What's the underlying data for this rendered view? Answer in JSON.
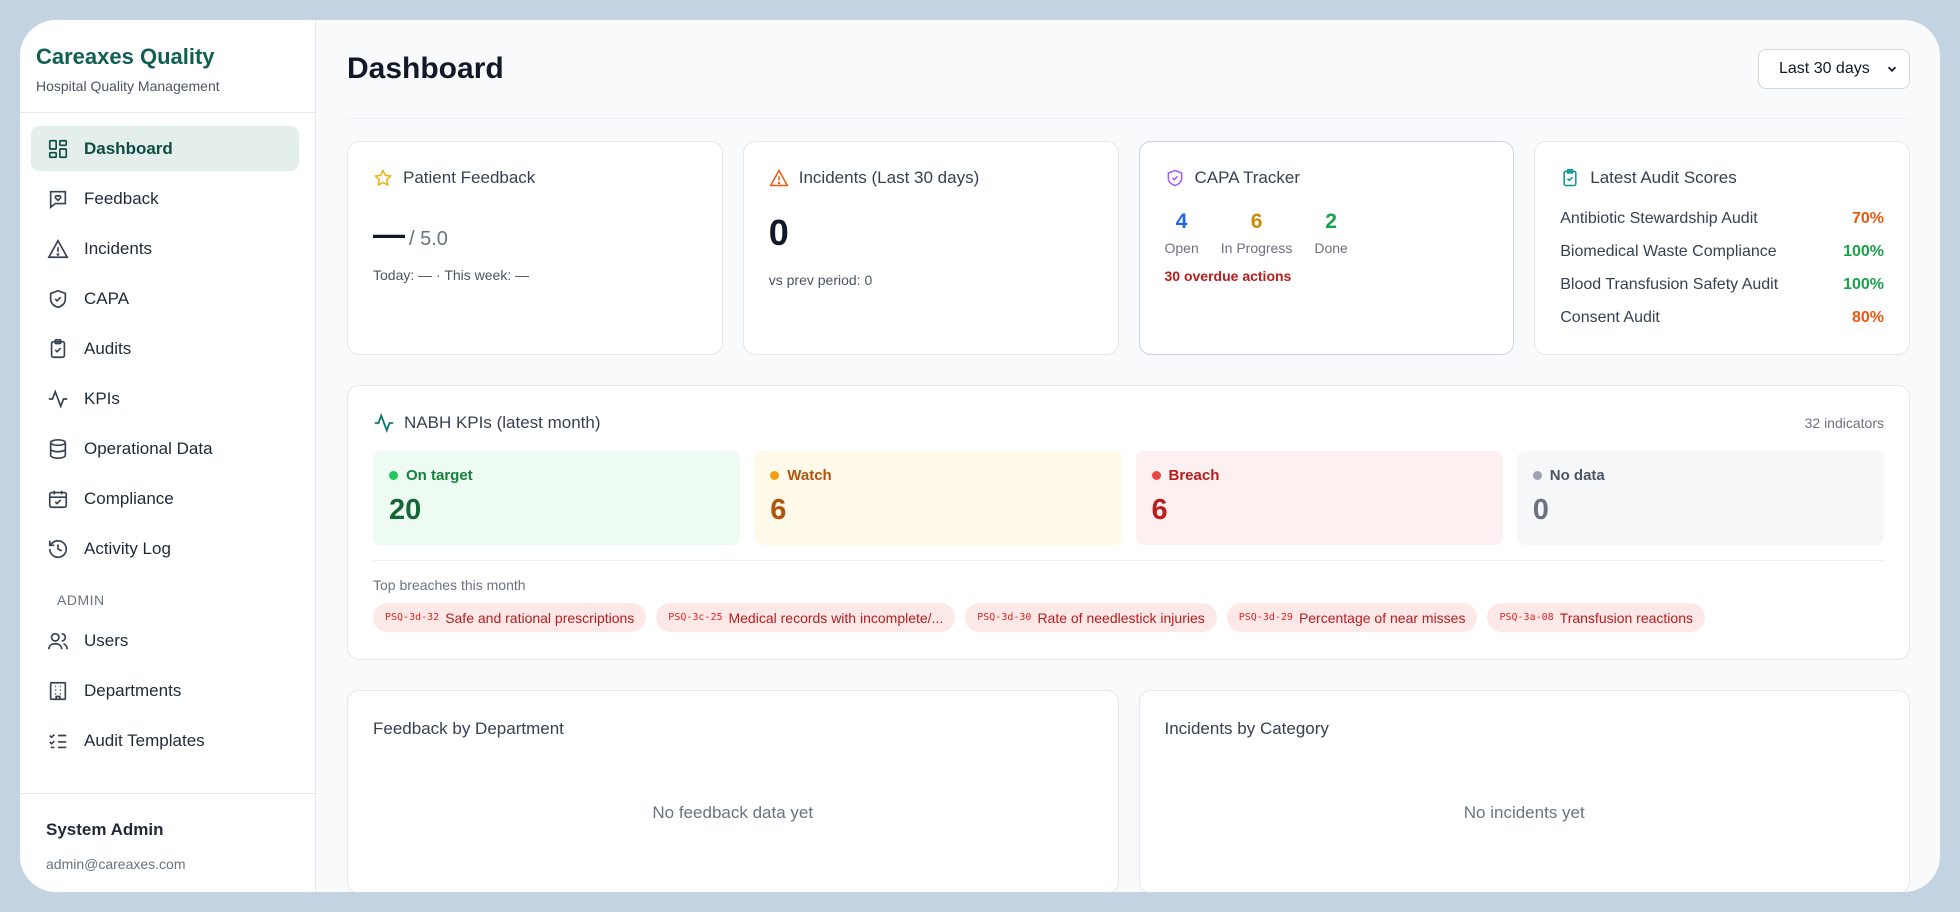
{
  "sidebar": {
    "brand_title": "Careaxes Quality",
    "brand_subtitle": "Hospital Quality Management",
    "items": [
      {
        "label": "Dashboard",
        "icon": "layout-grid-icon",
        "active": true
      },
      {
        "label": "Feedback",
        "icon": "feedback-icon"
      },
      {
        "label": "Incidents",
        "icon": "alert-triangle-icon"
      },
      {
        "label": "CAPA",
        "icon": "shield-check-icon"
      },
      {
        "label": "Audits",
        "icon": "clipboard-check-icon"
      },
      {
        "label": "KPIs",
        "icon": "activity-icon"
      },
      {
        "label": "Operational Data",
        "icon": "database-icon"
      },
      {
        "label": "Compliance",
        "icon": "calendar-check-icon"
      },
      {
        "label": "Activity Log",
        "icon": "history-icon"
      }
    ],
    "admin_section": "ADMIN",
    "admin_items": [
      {
        "label": "Users",
        "icon": "users-icon"
      },
      {
        "label": "Departments",
        "icon": "building-icon"
      },
      {
        "label": "Audit Templates",
        "icon": "list-checks-icon"
      }
    ],
    "user_name": "System Admin",
    "user_email": "admin@careaxes.com"
  },
  "header": {
    "title": "Dashboard",
    "range_value": "Last 30 days"
  },
  "patient_feedback": {
    "title": "Patient Feedback",
    "value": "—",
    "max": "/ 5.0",
    "sub": "Today: — · This week: —"
  },
  "incidents": {
    "title": "Incidents (Last 30 days)",
    "value": "0",
    "sub": "vs prev period: 0"
  },
  "capa": {
    "title": "CAPA Tracker",
    "stats": [
      {
        "value": "4",
        "label": "Open",
        "color": "#2563eb"
      },
      {
        "value": "6",
        "label": "In Progress",
        "color": "#ca8a04"
      },
      {
        "value": "2",
        "label": "Done",
        "color": "#16a34a"
      }
    ],
    "overdue": "30 overdue actions"
  },
  "audits": {
    "title": "Latest Audit Scores",
    "rows": [
      {
        "name": "Antibiotic Stewardship Audit",
        "score": "70%",
        "color": "#ea580c"
      },
      {
        "name": "Biomedical Waste Compliance",
        "score": "100%",
        "color": "#16a34a"
      },
      {
        "name": "Blood Transfusion Safety Audit",
        "score": "100%",
        "color": "#16a34a"
      },
      {
        "name": "Consent Audit",
        "score": "80%",
        "color": "#ea580c"
      }
    ]
  },
  "kpis": {
    "title": "NABH KPIs (latest month)",
    "count": "32 indicators",
    "tiles": [
      {
        "label": "On target",
        "value": "20",
        "bg": "#edfbf2",
        "dot": "#22c55e",
        "text": "#15803d",
        "value_color": "#166534"
      },
      {
        "label": "Watch",
        "value": "6",
        "bg": "#fef9e9",
        "dot": "#f59e0b",
        "text": "#b45309",
        "value_color": "#b45309"
      },
      {
        "label": "Breach",
        "value": "6",
        "bg": "#fdf0f0",
        "dot": "#ef4444",
        "text": "#b91c1c",
        "value_color": "#b91c1c"
      },
      {
        "label": "No data",
        "value": "0",
        "bg": "#f6f7f9",
        "dot": "#9ca3af",
        "text": "#4b5563",
        "value_color": "#6b7280"
      }
    ],
    "breach_label": "Top breaches this month",
    "breaches": [
      {
        "code": "PSQ-3d-32",
        "label": "Safe and rational prescriptions"
      },
      {
        "code": "PSQ-3c-25",
        "label": "Medical records with incomplete/..."
      },
      {
        "code": "PSQ-3d-30",
        "label": "Rate of needlestick injuries"
      },
      {
        "code": "PSQ-3d-29",
        "label": "Percentage of near misses"
      },
      {
        "code": "PSQ-3a-08",
        "label": "Transfusion reactions"
      }
    ]
  },
  "feedback_by_dept": {
    "title": "Feedback by Department",
    "empty": "No feedback data yet"
  },
  "incidents_by_cat": {
    "title": "Incidents by Category",
    "empty": "No incidents yet"
  }
}
